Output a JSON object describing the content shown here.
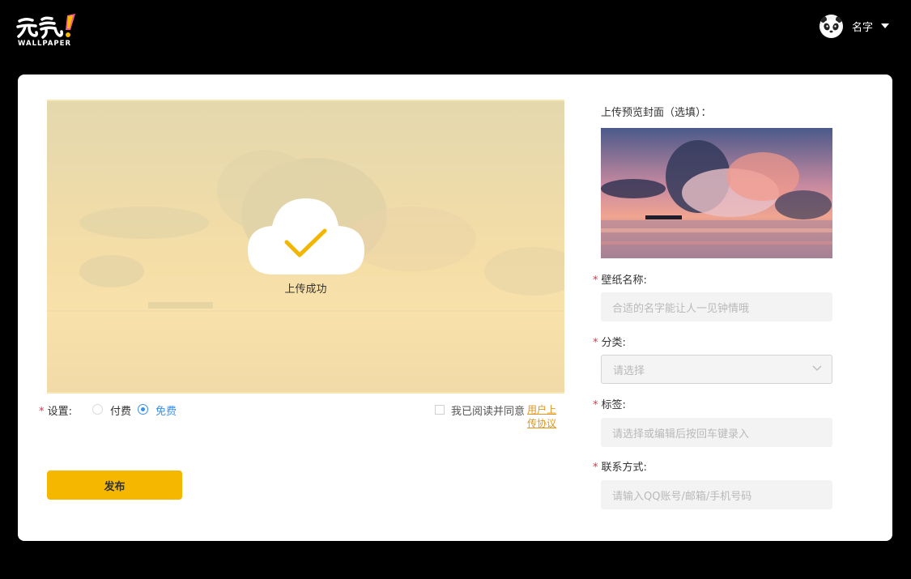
{
  "header": {
    "logo_text": "WALLPAPER",
    "user_name": "名字"
  },
  "upload": {
    "status": "上传成功"
  },
  "settings": {
    "label": "设置:",
    "options": [
      "付费",
      "免费"
    ],
    "selected": "免费",
    "agree_text": "我已阅读并同意",
    "agree_link": "用户上传协议"
  },
  "publish_label": "发布",
  "form": {
    "preview_label": "上传预览封面（选填）：",
    "name_label": "壁纸名称:",
    "name_placeholder": "合适的名字能让人一见钟情哦",
    "category_label": "分类:",
    "category_placeholder": "请选择",
    "tags_label": "标签:",
    "tags_placeholder": "请选择或编辑后按回车键录入",
    "contact_label": "联系方式:",
    "contact_placeholder": "请输入QQ账号/邮箱/手机号码"
  },
  "colors": {
    "accent": "#f5b700",
    "radio_active": "#3b8fe8",
    "required": "#e2324a",
    "link": "#e0951a"
  },
  "icons": {
    "logo": "yuanqi-logo-icon",
    "avatar": "panda-avatar-icon",
    "upload_success": "cloud-check-icon",
    "dropdown": "chevron-down-icon"
  }
}
